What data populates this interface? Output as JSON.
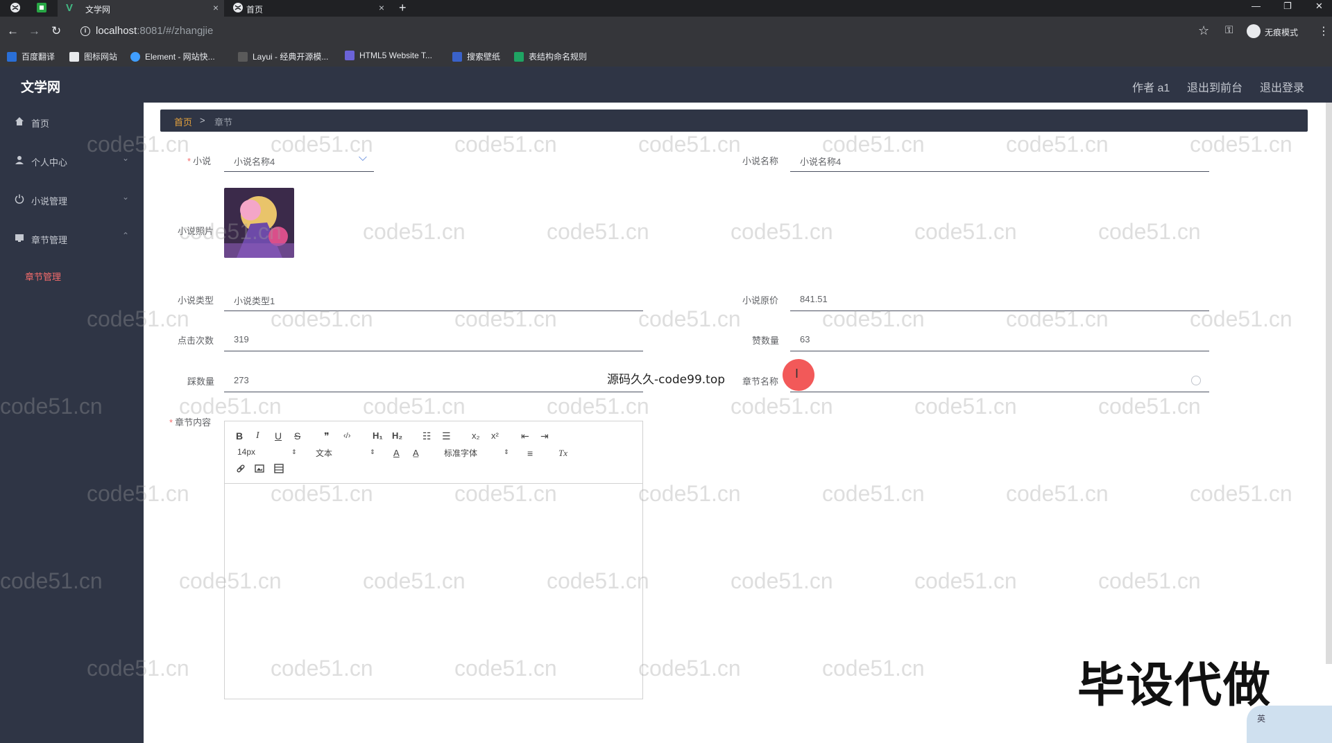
{
  "browser": {
    "tabs": [
      {
        "label": "文学网",
        "active": true
      },
      {
        "label": "首页",
        "active": false
      }
    ],
    "url_host": "localhost",
    "url_path": ":8081/#/zhangjie",
    "incognito_label": "无痕模式",
    "bookmarks": [
      "百度翻译",
      "图标网站",
      "Element - 网站快...",
      "Layui - 经典开源模...",
      "HTML5 Website T...",
      "搜索壁纸",
      "表结构命名规则"
    ]
  },
  "app": {
    "title": "文学网",
    "header_links": [
      "作者 a1",
      "退出到前台",
      "退出登录"
    ]
  },
  "sidebar": {
    "items": [
      {
        "label": "首页",
        "icon": "home-icon",
        "arrow": ""
      },
      {
        "label": "个人中心",
        "icon": "user-icon",
        "arrow": "⌄"
      },
      {
        "label": "小说管理",
        "icon": "power-icon",
        "arrow": "⌄"
      },
      {
        "label": "章节管理",
        "icon": "book-icon",
        "arrow": "⌃"
      }
    ],
    "sub_item": "章节管理"
  },
  "breadcrumb": {
    "home": "首页",
    "separator": ">",
    "current": "章节"
  },
  "form": {
    "novel_label": "小说",
    "novel_value": "小说名称4",
    "novel_name_label": "小说名称",
    "novel_name_value": "小说名称4",
    "photo_label": "小说照片",
    "type_label": "小说类型",
    "type_value": "小说类型1",
    "price_label": "小说原价",
    "price_value": "841.51",
    "clicks_label": "点击次数",
    "clicks_value": "319",
    "likes_label": "赞数量",
    "likes_value": "63",
    "dislikes_label": "踩数量",
    "dislikes_value": "273",
    "chapter_name_label": "章节名称",
    "chapter_name_value": "",
    "content_label": "章节内容"
  },
  "editor": {
    "row1": [
      "B",
      "I",
      "U",
      "S",
      "❞",
      "‹/›",
      "H₁",
      "H₂",
      "☷",
      "☰",
      "x₂",
      "x²",
      "⇤",
      "⇥"
    ],
    "size": "14px",
    "paragraph": "文本",
    "font": "标准字体",
    "color_icons": [
      "A",
      "A̲"
    ],
    "align_icon": "≡",
    "clear_icon": "Tx"
  },
  "overlays": {
    "ad_text": "源码久久-code99.top",
    "big_ad": "毕设代做",
    "watermark": "code51.cn",
    "ime": "英"
  }
}
